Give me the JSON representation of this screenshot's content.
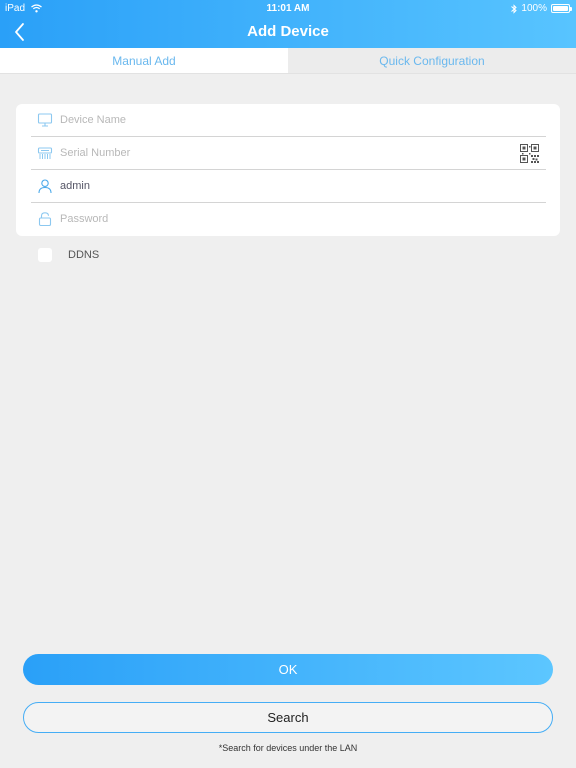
{
  "status_bar": {
    "device": "iPad",
    "time": "11:01 AM",
    "battery": "100%",
    "battery_level": 1.0
  },
  "nav": {
    "title": "Add Device",
    "back_icon": "chevron-left-icon"
  },
  "tabs": [
    {
      "label": "Manual Add",
      "active": true
    },
    {
      "label": "Quick Configuration",
      "active": false
    }
  ],
  "form": {
    "device_name": {
      "placeholder": "Device Name",
      "value": "",
      "icon": "monitor-icon"
    },
    "serial_number": {
      "placeholder": "Serial Number",
      "value": "",
      "icon": "device-icon",
      "action_icon": "qr-code-icon"
    },
    "username": {
      "placeholder": "",
      "value": "admin",
      "icon": "user-icon"
    },
    "password": {
      "placeholder": "Password",
      "value": "",
      "icon": "lock-icon"
    }
  },
  "ddns": {
    "label": "DDNS",
    "checked": false
  },
  "buttons": {
    "ok_label": "OK",
    "search_label": "Search"
  },
  "footnote": "*Search for devices under the LAN",
  "colors": {
    "accent": "#2aa0f8",
    "accent_light": "#58c4ff",
    "tab_text": "#6ab8ee",
    "background": "#efefef"
  }
}
